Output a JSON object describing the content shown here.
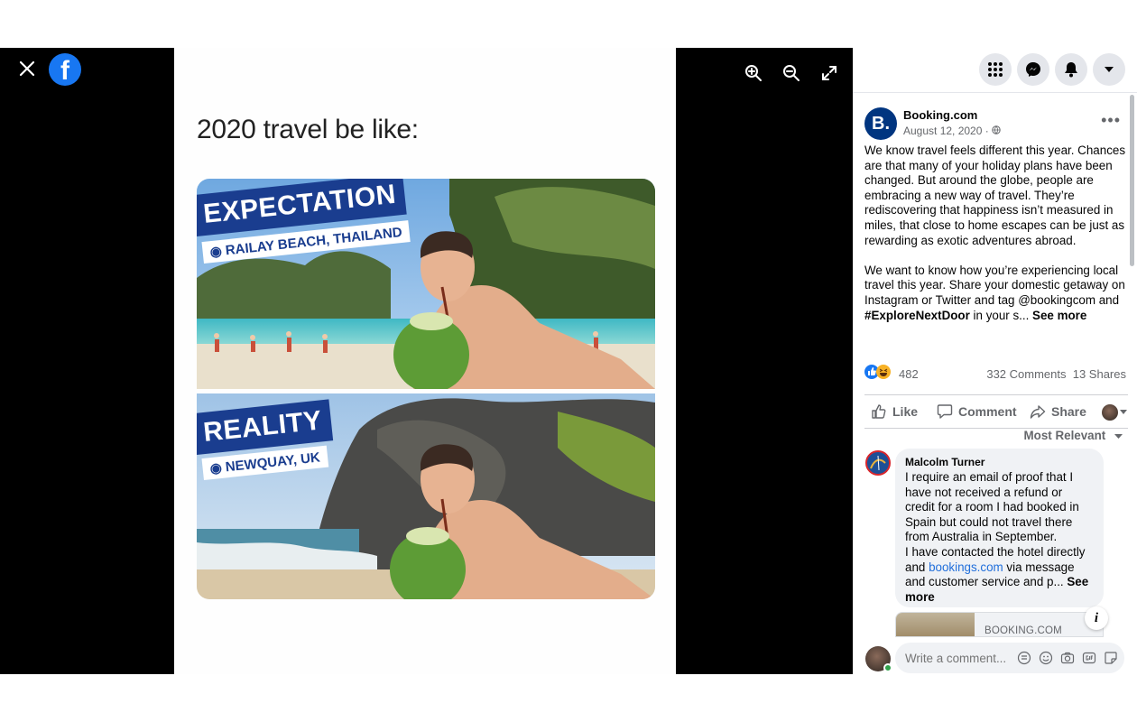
{
  "viewer": {
    "close_icon": "close-icon",
    "logo_letter": "f",
    "tools": [
      "zoom-in-icon",
      "zoom-out-icon",
      "fullscreen-icon"
    ]
  },
  "meme": {
    "caption": "2020 travel be like:",
    "top_banner": "EXPECTATION",
    "top_location": "RAILAY BEACH, THAILAND",
    "bottom_banner": "REALITY",
    "bottom_location": "NEWQUAY, UK"
  },
  "header_icons": [
    "menu-grid-icon",
    "messenger-icon",
    "notifications-icon",
    "account-dropdown-icon"
  ],
  "post": {
    "page_avatar_letter": "B.",
    "page_name": "Booking.com",
    "date": "August 12, 2020 · ",
    "body_p1": "We know travel feels different this year. Chances are that many of your holiday plans have been changed. But around the globe, people are embracing a new way of travel. They’re rediscovering that happiness isn’t measured in miles, that close to home escapes can be just as rewarding as exotic adventures abroad.",
    "body_p2_start": "We want to know how you’re experiencing local travel this year. Share your domestic getaway on Instagram or Twitter and tag @bookingcom and ",
    "hashtag": "#ExploreNextDoor",
    "body_p2_end": " in your s... ",
    "see_more": "See more"
  },
  "stats": {
    "reaction_count": "482",
    "comments": "332 Comments",
    "shares": "13 Shares"
  },
  "actions": {
    "like": "Like",
    "comment": "Comment",
    "share": "Share"
  },
  "sort_label": "Most Relevant",
  "comment": {
    "author": "Malcolm Turner",
    "text_1": "I require an email of proof that I have not received a refund or credit for a room I had booked in Spain but could not travel there from Australia in September.",
    "text_2_start": "I have contacted the hotel directly and ",
    "link": "bookings.com",
    "text_2_end": " via message and customer service and p... ",
    "see_more": "See more",
    "preview_domain": "BOOKING.COM"
  },
  "composer": {
    "placeholder": "Write a comment..."
  },
  "colors": {
    "brand_blue": "#1877f2",
    "booking_blue": "#003580",
    "link_blue": "#216fdb"
  }
}
